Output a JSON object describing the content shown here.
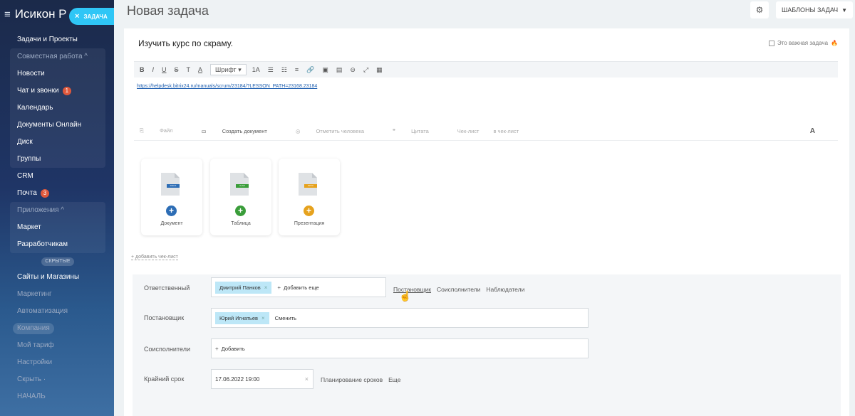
{
  "sidebar": {
    "logo": "Исикон Р",
    "task_pill": "ЗАДАЧА",
    "items": [
      {
        "label": "Задачи и Проекты",
        "dim": false
      },
      {
        "label": "Совместная работа ^",
        "dim": true,
        "group_header": true
      },
      {
        "label": "Новости",
        "dim": false,
        "grouped": true
      },
      {
        "label": "Чат и звонки",
        "dim": false,
        "grouped": true,
        "badge": "1"
      },
      {
        "label": "Календарь",
        "dim": false,
        "grouped": true
      },
      {
        "label": "Документы Онлайн",
        "dim": false,
        "grouped": true
      },
      {
        "label": "Диск",
        "dim": false,
        "grouped": true
      },
      {
        "label": "Группы",
        "dim": false,
        "grouped": true
      },
      {
        "label": "CRM",
        "dim": false
      },
      {
        "label": "Почта",
        "dim": false,
        "badge": "3"
      },
      {
        "label": "Приложения ^",
        "dim": true
      },
      {
        "label": "Маркет",
        "dim": false
      },
      {
        "label": "Разработчикам",
        "dim": false
      }
    ],
    "hidden_pill": "СКРЫТЫЕ",
    "items2": [
      {
        "label": "Сайты и Магазины",
        "dim": false
      },
      {
        "label": "Маркетинг",
        "dim": true
      },
      {
        "label": "Автоматизация",
        "dim": true
      },
      {
        "label": "Компания",
        "dim": true,
        "active": true
      },
      {
        "label": "Мой тариф",
        "dim": true
      },
      {
        "label": "Настройки",
        "dim": true
      },
      {
        "label": "Скрыть ·",
        "dim": true
      },
      {
        "label": "НАЧАЛЬ",
        "dim": true
      }
    ]
  },
  "header": {
    "title": "Новая задача",
    "templates_label": "ШАБЛОНЫ ЗАДАЧ"
  },
  "task": {
    "title": "Изучить курс по скраму.",
    "important_label": "Это важная задача",
    "link": "https://helpdesk.bitrix24.ru/manuals/scrum/23184/?LESSON_PATH=23168.23184"
  },
  "toolbar": {
    "font_label": "Шрифт",
    "size_label": "1A",
    "buttons": [
      "B",
      "I",
      "U",
      "S",
      "T",
      "A"
    ]
  },
  "attach": {
    "file": "Файл",
    "create_doc": "Создать документ",
    "mention": "Отметить человека",
    "quote": "Цитата",
    "checklist": "Чек-лист",
    "to_checklist": "в чек-лист"
  },
  "docs": [
    {
      "name": "Документ",
      "tag": "DOCX",
      "color": "#2d6db5"
    },
    {
      "name": "Таблица",
      "tag": "XLSX",
      "color": "#3a9d3a"
    },
    {
      "name": "Презентация",
      "tag": "PPTX",
      "color": "#e6a21d"
    }
  ],
  "add_checklist": "+ добавить чек-лист",
  "form": {
    "responsible": {
      "label": "Ответственный",
      "chip": "Дмитрий Панков",
      "add_more": "Добавить еще",
      "side_links": [
        "Постановщик",
        "Соисполнители",
        "Наблюдатели"
      ]
    },
    "creator": {
      "label": "Постановщик",
      "chip": "Юрий Игнатьев",
      "change": "Сменить"
    },
    "accomplices": {
      "label": "Соисполнители",
      "add": "Добавить"
    },
    "deadline": {
      "label": "Крайний срок",
      "value": "17.06.2022 19:00",
      "planning": "Планирование сроков",
      "more": "Еще"
    }
  }
}
